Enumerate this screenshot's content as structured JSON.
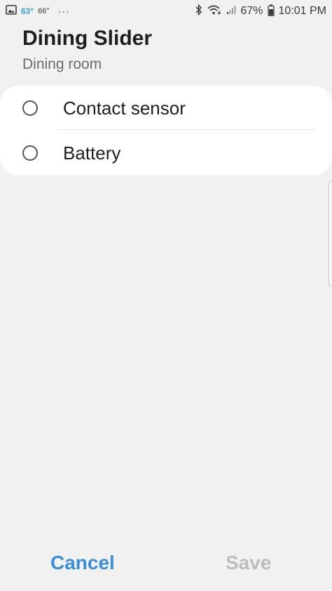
{
  "status_bar": {
    "left_icons": [
      "gallery-icon"
    ],
    "temp_current": "63°",
    "temp_high": "66°",
    "more": "···",
    "battery_percent": "67%",
    "time": "10:01 PM"
  },
  "header": {
    "title": "Dining Slider",
    "subtitle": "Dining room"
  },
  "options": [
    {
      "label": "Contact sensor",
      "selected": false
    },
    {
      "label": "Battery",
      "selected": false
    }
  ],
  "buttons": {
    "cancel_label": "Cancel",
    "save_label": "Save"
  },
  "colors": {
    "accent": "#3b8fd8",
    "disabled": "#bdbdbd",
    "background": "#f1f1f1"
  }
}
